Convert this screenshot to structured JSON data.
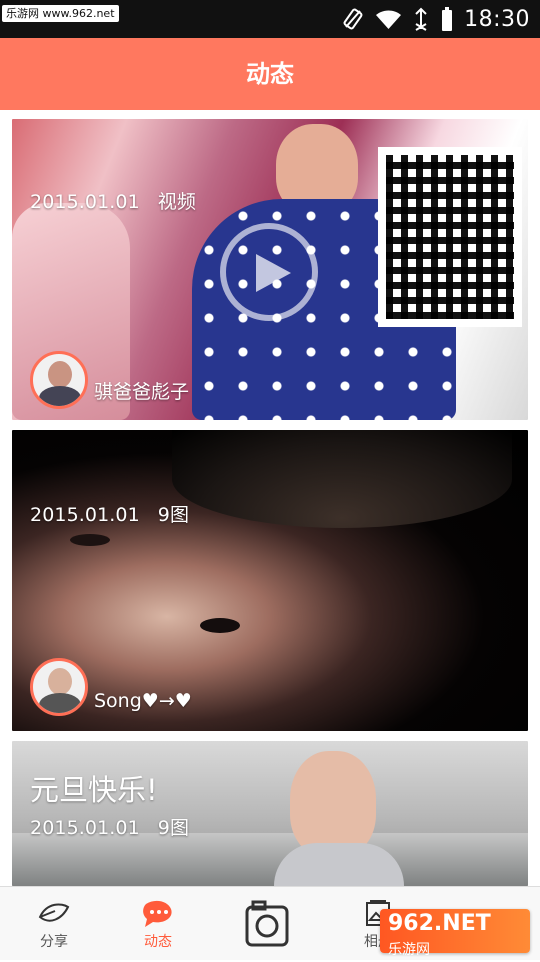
{
  "status_bar": {
    "watermark": "乐游网 www.962.net",
    "time": "18:30"
  },
  "header": {
    "title": "动态"
  },
  "feed": {
    "posts": [
      {
        "date": "2015.01.01",
        "kind": "视频",
        "author": "骐爸爸彪子"
      },
      {
        "date": "2015.01.01",
        "kind": "9图",
        "author": "Song♥→♥"
      },
      {
        "title": "元旦快乐!",
        "date": "2015.01.01",
        "kind": "9图"
      }
    ]
  },
  "bottom_nav": {
    "items": [
      {
        "label": "分享",
        "icon": "leaf-icon"
      },
      {
        "label": "动态",
        "icon": "chat-bubble-icon",
        "active": true
      },
      {
        "label": "",
        "icon": "camera-icon"
      },
      {
        "label": "相册",
        "icon": "album-icon"
      }
    ],
    "overlay_logo": "962.NET",
    "overlay_text": "乐游网"
  },
  "colors": {
    "accent": "#ff785f",
    "active": "#ff5b3b"
  }
}
